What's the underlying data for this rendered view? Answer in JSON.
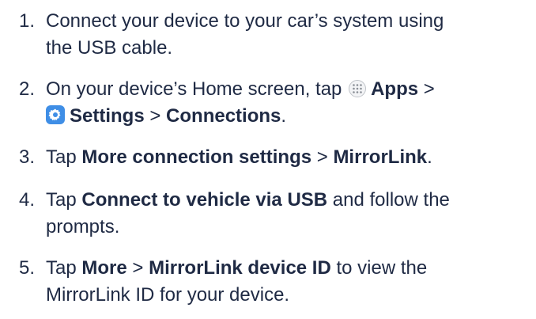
{
  "steps": [
    {
      "number": "1.",
      "line1": "Connect your device to your car’s system using",
      "line2": "the USB cable."
    },
    {
      "number": "2.",
      "pre": "On your device’s Home screen, tap ",
      "apps": "Apps",
      "sep1": " >",
      "settings": "Settings",
      "sep2": " > ",
      "connections": "Connections",
      "end": ".",
      "icons": [
        "apps-icon",
        "settings-gear-icon"
      ]
    },
    {
      "number": "3.",
      "pre": "Tap ",
      "b1": "More connection settings",
      "sep": " > ",
      "b2": "MirrorLink",
      "end": "."
    },
    {
      "number": "4.",
      "pre": "Tap ",
      "b1": "Connect to vehicle via USB",
      "post": " and follow the",
      "line2": "prompts."
    },
    {
      "number": "5.",
      "pre": "Tap ",
      "b1": "More",
      "sep": " > ",
      "b2": "MirrorLink device ID",
      "post": " to view the",
      "line2": "MirrorLink ID for your device."
    }
  ],
  "colors": {
    "text": "#1f2a44",
    "settings_icon_bg": "#3f8ee6",
    "apps_icon_border": "#bfc3c8"
  }
}
